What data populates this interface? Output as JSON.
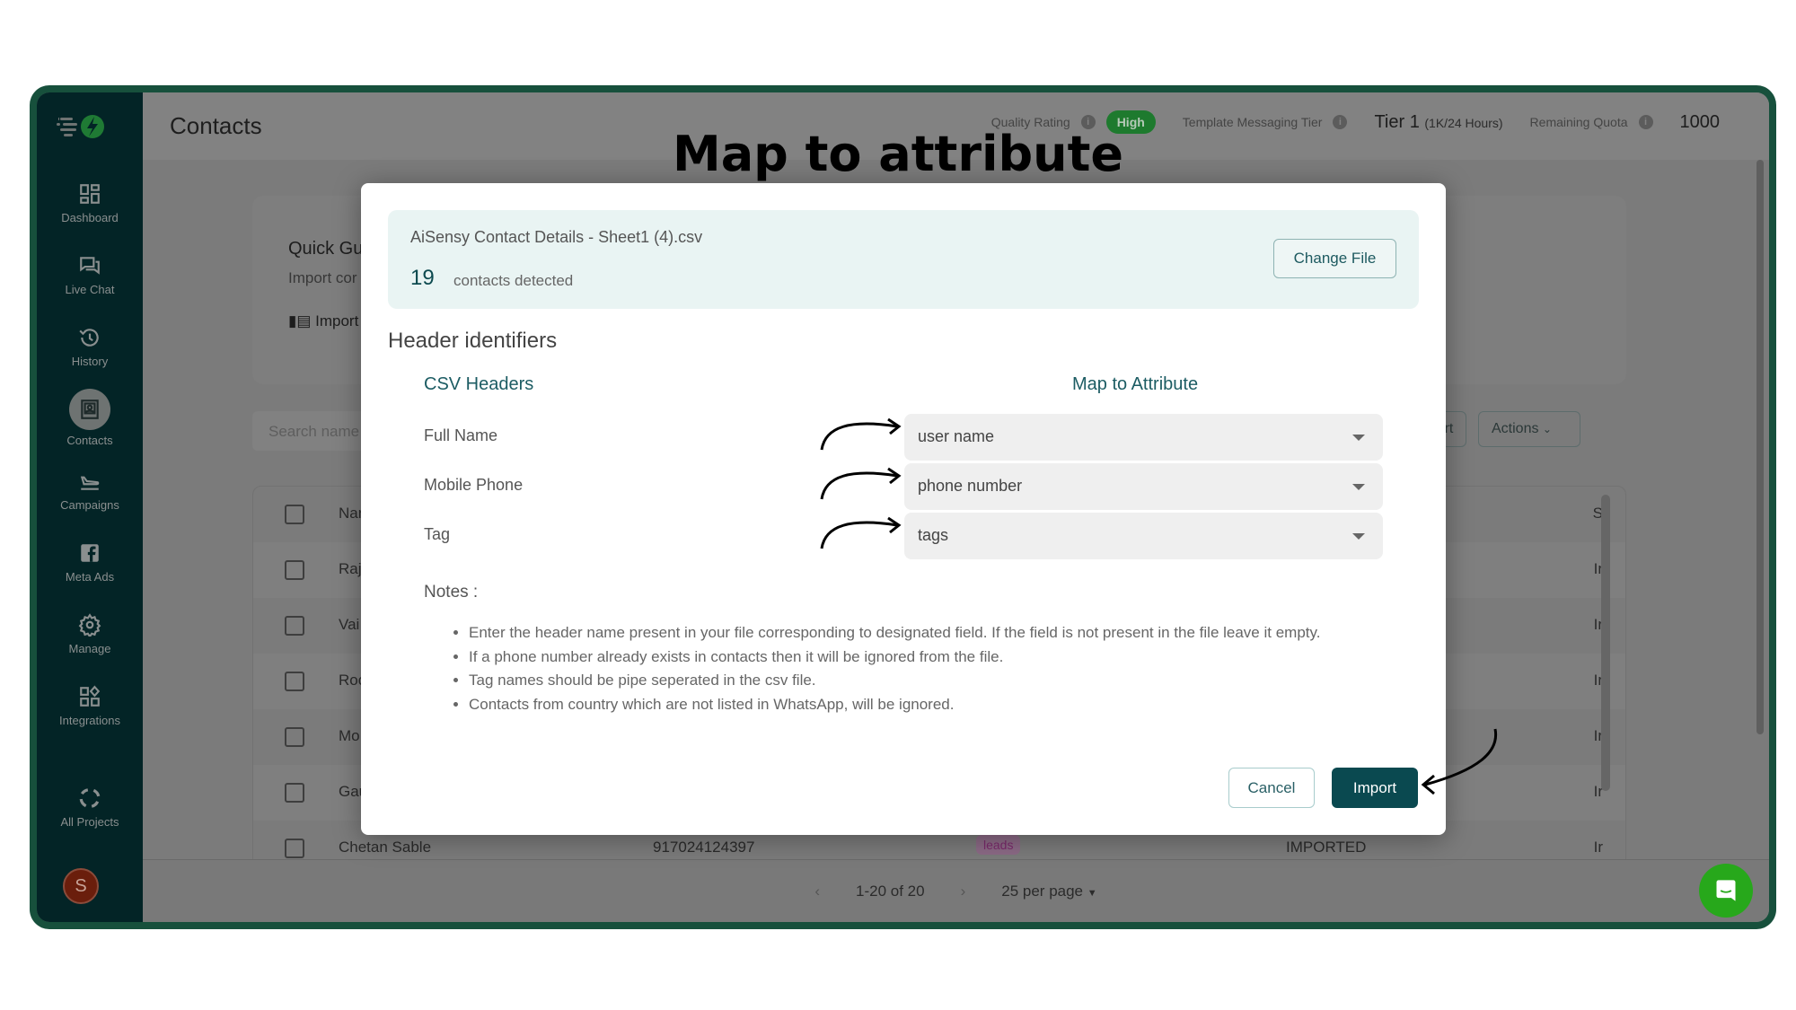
{
  "annotation": {
    "title": "Map to attribute"
  },
  "sidebar": {
    "items": [
      {
        "label": "Dashboard",
        "icon": "dashboard-icon"
      },
      {
        "label": "Live Chat",
        "icon": "chat-icon"
      },
      {
        "label": "History",
        "icon": "history-icon"
      },
      {
        "label": "Contacts",
        "icon": "contacts-icon",
        "active": true
      },
      {
        "label": "Campaigns",
        "icon": "campaign-plane-icon"
      },
      {
        "label": "Meta Ads",
        "icon": "facebook-icon"
      },
      {
        "label": "Manage",
        "icon": "gear-icon"
      },
      {
        "label": "Integrations",
        "icon": "integrations-icon"
      },
      {
        "label": "All Projects",
        "icon": "projects-ring-icon"
      }
    ],
    "avatar_letter": "S"
  },
  "header": {
    "title": "Contacts",
    "quality_rating_label": "Quality Rating",
    "quality_rating_value": "High",
    "tier_label": "Template Messaging Tier",
    "tier_value": "Tier 1",
    "tier_detail": "(1K/24 Hours)",
    "quota_label": "Remaining Quota",
    "quota_value": "1000"
  },
  "background": {
    "quick_guide_title": "Quick Gu",
    "quick_guide_sub": "Import cor",
    "quick_guide_link": "Import",
    "search_placeholder": "Search name",
    "import_label": "Import",
    "actions_label": "Actions",
    "table": {
      "header_name": "Nar",
      "header_status": "S",
      "rows": [
        {
          "name": "Raj",
          "status": "Ir"
        },
        {
          "name": "Vai",
          "status": "Ir"
        },
        {
          "name": "Roc",
          "status": "Ir"
        },
        {
          "name": "Mo",
          "status": "Ir"
        },
        {
          "name": "Gau",
          "status": "Ir"
        },
        {
          "name": "Chetan Sable",
          "phone": "917024124397",
          "tag": "leads",
          "state": "IMPORTED",
          "status": "Ir"
        }
      ]
    },
    "pagination": {
      "range": "1-20 of 20",
      "per_page": "25 per page"
    }
  },
  "modal": {
    "file_name": "AiSensy Contact Details - Sheet1 (4).csv",
    "contacts_count": "19",
    "contacts_label": "contacts detected",
    "change_file_label": "Change File",
    "section_title": "Header identifiers",
    "csv_headers_label": "CSV Headers",
    "map_attr_label": "Map to Attribute",
    "mappings": [
      {
        "csv_header": "Full Name",
        "attribute": "user name"
      },
      {
        "csv_header": "Mobile Phone",
        "attribute": "phone number"
      },
      {
        "csv_header": "Tag",
        "attribute": "tags"
      }
    ],
    "notes_title": "Notes :",
    "notes": [
      "Enter the header name present in your file corresponding to designated field. If the field is not present in the file leave it empty.",
      "If a phone number already exists in contacts then it will be ignored from the file.",
      "Tag names should be pipe seperated in the csv file.",
      "Contacts from country which are not listed in WhatsApp, will be ignored."
    ],
    "cancel_label": "Cancel",
    "import_label": "Import"
  },
  "colors": {
    "frame": "#17503c",
    "sidebar": "#032426",
    "accent": "#0a4950",
    "high_badge": "#1e7a2e",
    "chat_fab": "#27a81b"
  }
}
